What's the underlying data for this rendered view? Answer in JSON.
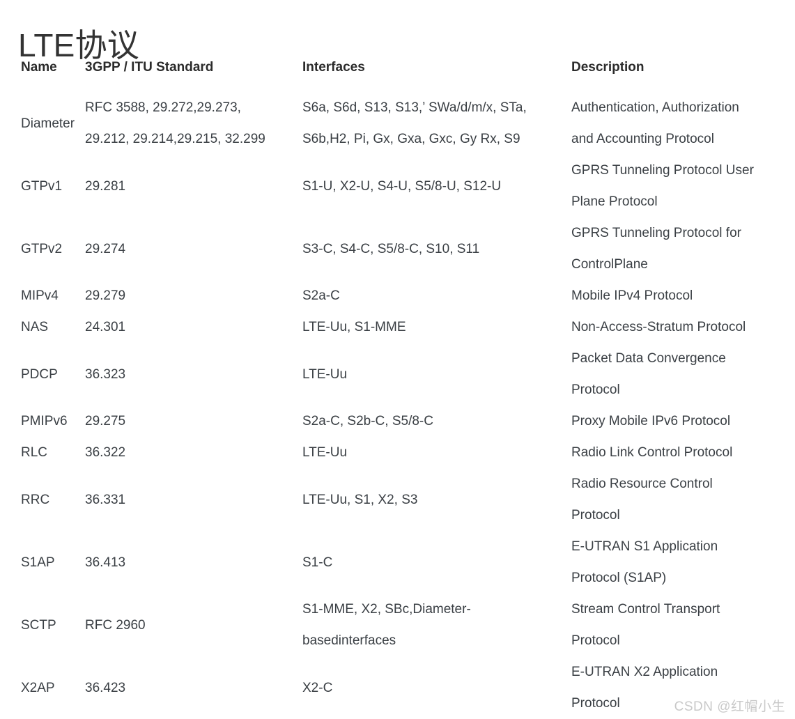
{
  "document": {
    "title": "LTE协议",
    "watermark": "CSDN @红帽小生",
    "text_color": "#3a3f44",
    "heading_color": "#333333",
    "background_color": "#ffffff",
    "watermark_color": "#c9c9c9"
  },
  "table": {
    "columns": [
      {
        "key": "name",
        "label": "Name"
      },
      {
        "key": "standard",
        "label": "3GPP / ITU Standard"
      },
      {
        "key": "interfaces",
        "label": "Interfaces"
      },
      {
        "key": "description",
        "label": "Description"
      }
    ],
    "rows": [
      {
        "name": "Diameter",
        "standard_lines": [
          "RFC 3588, 29.272,29.273,",
          "29.212, 29.214,29.215, 32.299"
        ],
        "interfaces_lines": [
          "S6a, S6d, S13, S13,’ SWa/d/m/x, STa,",
          "S6b,H2, Pi, Gx, Gxa, Gxc, Gy Rx, S9"
        ],
        "description_lines": [
          "Authentication, Authorization",
          "and Accounting Protocol"
        ]
      },
      {
        "name": "GTPv1",
        "standard_lines": [
          "29.281"
        ],
        "interfaces_lines": [
          "S1-U, X2-U, S4-U, S5/8-U, S12-U"
        ],
        "description_lines": [
          "GPRS Tunneling Protocol User",
          "Plane Protocol"
        ]
      },
      {
        "name": "GTPv2",
        "standard_lines": [
          "29.274"
        ],
        "interfaces_lines": [
          "S3-C, S4-C, S5/8-C, S10, S11"
        ],
        "description_lines": [
          "GPRS Tunneling Protocol for",
          "ControlPlane"
        ]
      },
      {
        "name": "MIPv4",
        "standard_lines": [
          "29.279"
        ],
        "interfaces_lines": [
          "S2a-C"
        ],
        "description_lines": [
          "Mobile IPv4 Protocol"
        ]
      },
      {
        "name": "NAS",
        "standard_lines": [
          "24.301"
        ],
        "interfaces_lines": [
          "LTE-Uu, S1-MME"
        ],
        "description_lines": [
          "Non-Access-Stratum Protocol"
        ]
      },
      {
        "name": "PDCP",
        "standard_lines": [
          "36.323"
        ],
        "interfaces_lines": [
          "LTE-Uu"
        ],
        "description_lines": [
          "Packet Data Convergence",
          "Protocol"
        ]
      },
      {
        "name": "PMIPv6",
        "standard_lines": [
          "29.275"
        ],
        "interfaces_lines": [
          "S2a-C, S2b-C, S5/8-C"
        ],
        "description_lines": [
          "Proxy Mobile IPv6 Protocol"
        ]
      },
      {
        "name": "RLC",
        "standard_lines": [
          "36.322"
        ],
        "interfaces_lines": [
          "LTE-Uu"
        ],
        "description_lines": [
          "Radio Link Control Protocol"
        ]
      },
      {
        "name": "RRC",
        "standard_lines": [
          "36.331"
        ],
        "interfaces_lines": [
          "LTE-Uu, S1, X2, S3"
        ],
        "description_lines": [
          "Radio Resource Control",
          "Protocol"
        ]
      },
      {
        "name": "S1AP",
        "standard_lines": [
          "36.413"
        ],
        "interfaces_lines": [
          "S1-C"
        ],
        "description_lines": [
          "E-UTRAN S1 Application",
          "Protocol (S1AP)"
        ]
      },
      {
        "name": "SCTP",
        "standard_lines": [
          "RFC 2960"
        ],
        "interfaces_lines": [
          "S1-MME, X2, SBc,Diameter-",
          "basedinterfaces"
        ],
        "description_lines": [
          "Stream Control Transport",
          "Protocol"
        ]
      },
      {
        "name": "X2AP",
        "standard_lines": [
          "36.423"
        ],
        "interfaces_lines": [
          "X2-C"
        ],
        "description_lines": [
          "E-UTRAN X2 Application",
          "Protocol"
        ]
      }
    ]
  }
}
